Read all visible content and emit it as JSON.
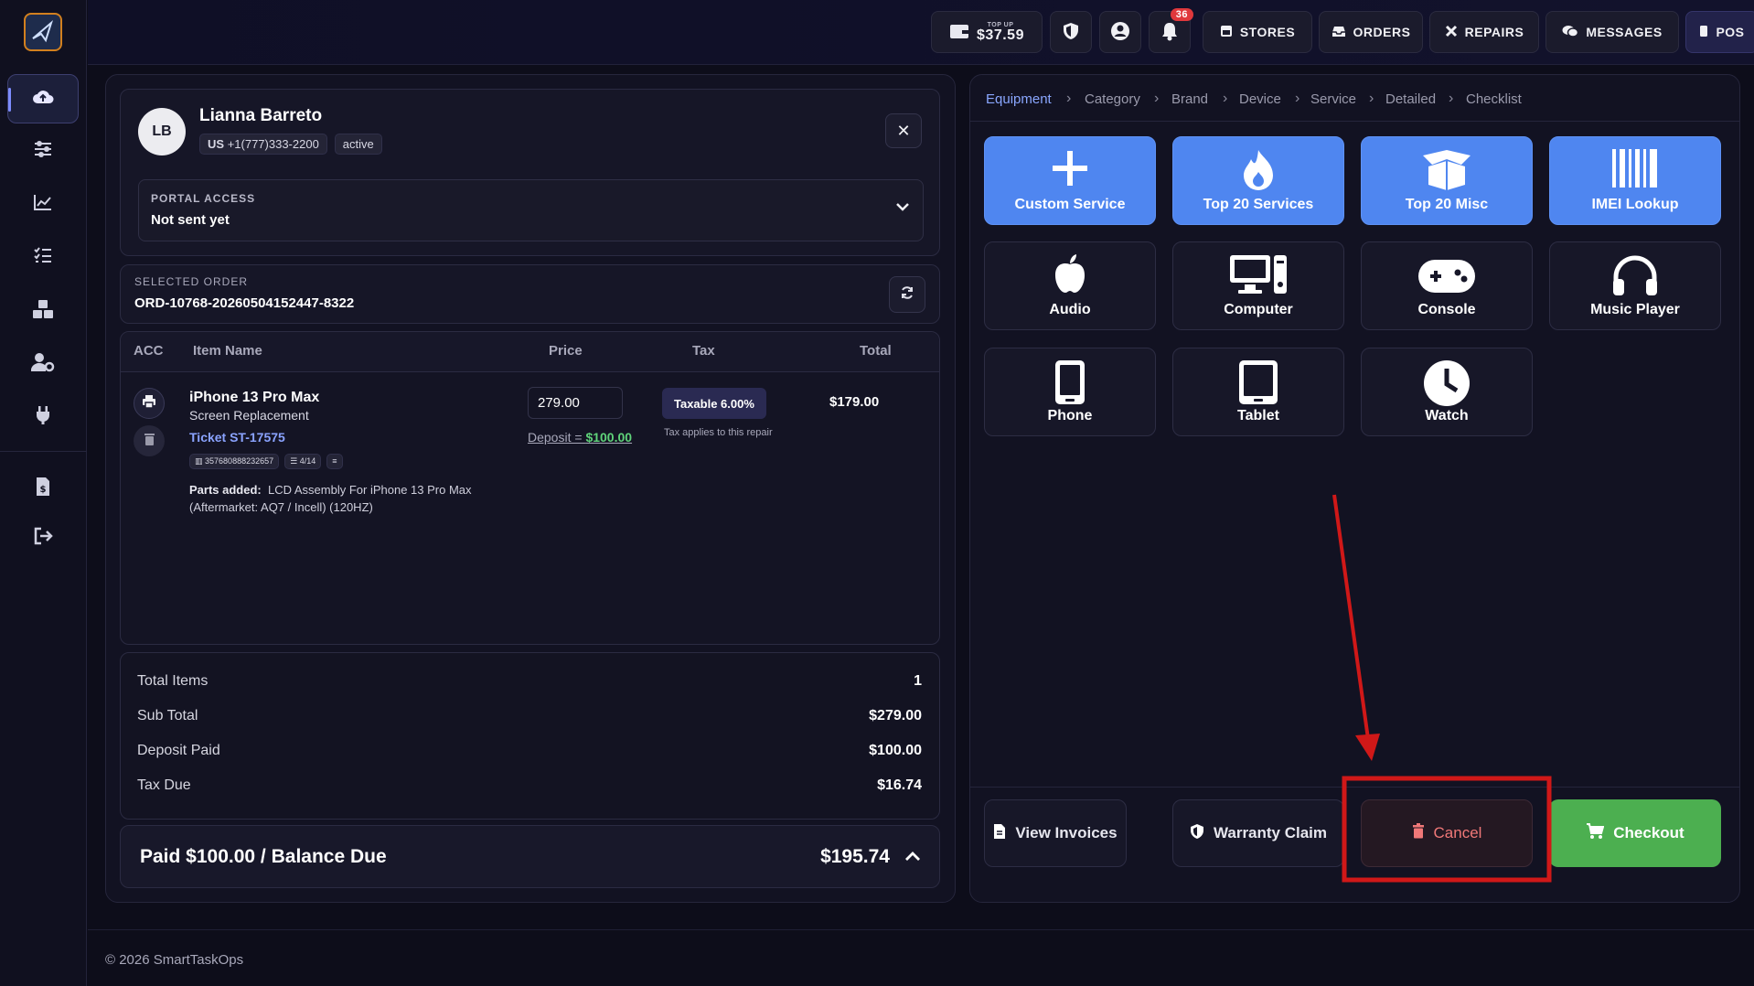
{
  "sidebar": {
    "items": [
      "cloud-upload-icon",
      "sliders-icon",
      "chart-line-icon",
      "checklist-icon",
      "boxes-icon",
      "user-gear-icon",
      "plug-icon",
      "invoice-icon",
      "sign-out-icon"
    ]
  },
  "topbar": {
    "topup_label": "TOP UP",
    "topup_amount": "$37.59",
    "notifications_count": "36",
    "nav": [
      "STORES",
      "ORDERS",
      "REPAIRS",
      "MESSAGES",
      "POS"
    ]
  },
  "customer": {
    "initials": "LB",
    "name": "Lianna Barreto",
    "country": "US",
    "phone": "+1(777)333-2200",
    "status": "active",
    "portal_label": "PORTAL ACCESS",
    "portal_value": "Not sent yet"
  },
  "order": {
    "label": "SELECTED ORDER",
    "id": "ORD-10768-20260504152447-8322"
  },
  "table": {
    "headers": [
      "ACC",
      "Item Name",
      "Price",
      "Tax",
      "Total"
    ],
    "item": {
      "name": "iPhone 13 Pro Max",
      "service": "Screen Replacement",
      "ticket": "Ticket ST-17575",
      "imei": "357680888232657",
      "checklist": "4/14",
      "parts_label": "Parts added:",
      "parts_line1": "LCD Assembly For iPhone 13 Pro Max",
      "parts_line2": "(Aftermarket: AQ7 / Incell) (120HZ)",
      "price": "279.00",
      "deposit_label": "Deposit =",
      "deposit_value": "$100.00",
      "tax_chip": "Taxable 6.00%",
      "tax_note": "Tax applies to this repair",
      "total": "$179.00"
    }
  },
  "summary": {
    "total_items_label": "Total Items",
    "total_items": "1",
    "subtotal_label": "Sub Total",
    "subtotal": "$279.00",
    "deposit_label": "Deposit Paid",
    "deposit": "$100.00",
    "tax_label": "Tax Due",
    "tax": "$16.74",
    "balance_label": "Paid $100.00 / Balance Due",
    "balance": "$195.74"
  },
  "breadcrumb": [
    "Equipment",
    "Category",
    "Brand",
    "Device",
    "Service",
    "Detailed",
    "Checklist"
  ],
  "tiles": {
    "custom": "Custom Service",
    "top20services": "Top 20 Services",
    "top20misc": "Top 20 Misc",
    "imei": "IMEI Lookup",
    "audio": "Audio",
    "computer": "Computer",
    "console": "Console",
    "music": "Music Player",
    "phone": "Phone",
    "tablet": "Tablet",
    "watch": "Watch"
  },
  "actions": {
    "view_invoices": "View Invoices",
    "warranty": "Warranty Claim",
    "cancel": "Cancel",
    "checkout": "Checkout"
  },
  "footer": "© 2026 SmartTaskOps",
  "colors": {
    "accent": "#4f86f0",
    "checkout": "#4caf50",
    "cancel_text": "#f07070",
    "highlight": "#d01818"
  }
}
